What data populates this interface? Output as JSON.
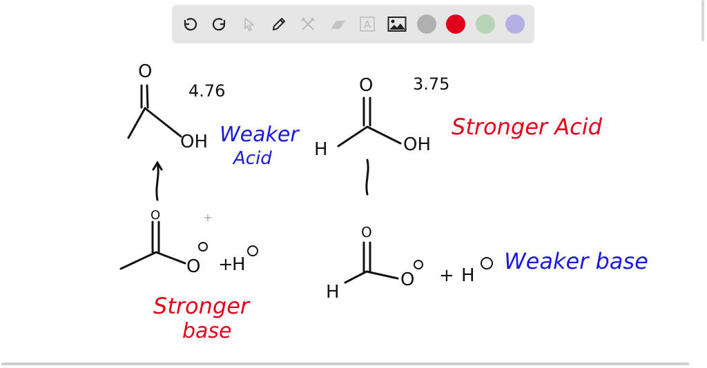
{
  "toolbar": {
    "tools": [
      "undo-icon",
      "redo-icon",
      "select-icon",
      "pen-icon",
      "tools-icon",
      "eraser-icon",
      "text-icon",
      "image-icon"
    ],
    "colors": [
      "#b0b0b0",
      "#e0001b",
      "#b8d4b8",
      "#b4b0e6"
    ]
  },
  "board": {
    "acetic": {
      "o_top": "O",
      "oh": "OH",
      "pka": "4.76",
      "label1": "Weaker",
      "label2": "Acid"
    },
    "formic": {
      "o_top": "O",
      "h": "H",
      "oh": "OH",
      "pka": "3.75",
      "label": "Stronger Acid"
    },
    "acetate": {
      "o_top": "O",
      "o_minus": "O",
      "plus": "+",
      "h": "H",
      "label1": "Stronger",
      "label2": "base"
    },
    "formate": {
      "o_top": "O",
      "h": "H",
      "o_minus": "O",
      "plus": "+",
      "h_plus": "H",
      "label": "Weaker base"
    },
    "colors": {
      "ink": "#111111",
      "blue": "#1a1adc",
      "red": "#e0001b"
    }
  }
}
